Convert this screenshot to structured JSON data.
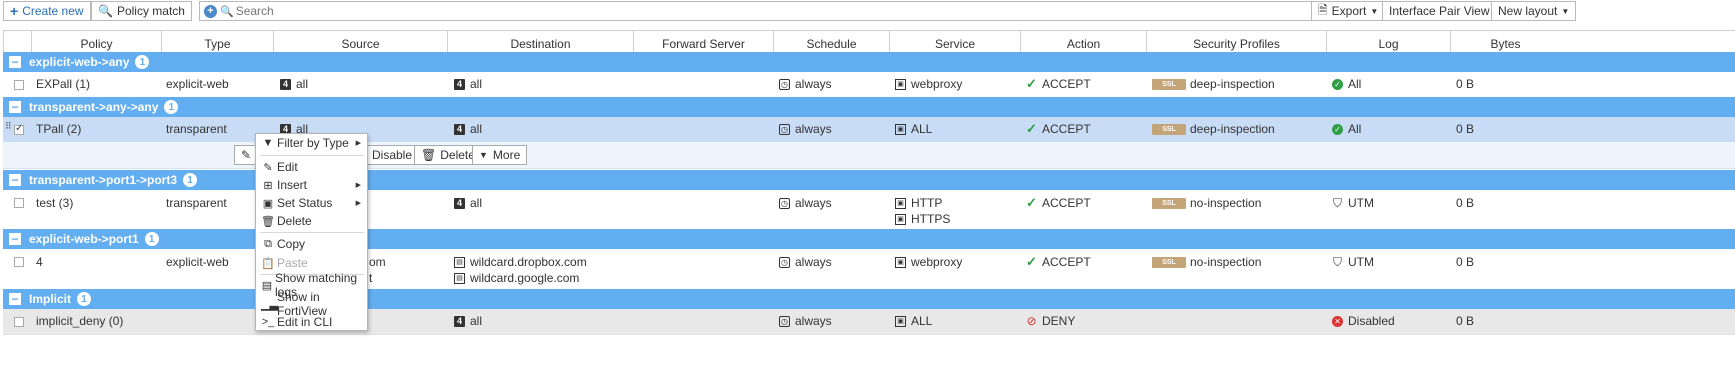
{
  "toolbar": {
    "create_new": "Create new",
    "policy_match": "Policy match",
    "search_placeholder": "Search",
    "export": "Export",
    "interface_pair_view": "Interface Pair View",
    "new_layout": "New layout"
  },
  "columns": [
    "Policy",
    "Type",
    "Source",
    "Destination",
    "Forward Server",
    "Schedule",
    "Service",
    "Action",
    "Security Profiles",
    "Log",
    "Bytes"
  ],
  "groups": [
    {
      "label": "explicit-web->any",
      "count": "1"
    },
    {
      "label": "transparent->any->any",
      "count": "1"
    },
    {
      "label": "transparent->port1->port3",
      "count": "1"
    },
    {
      "label": "explicit-web->port1",
      "count": "1"
    },
    {
      "label": "Implicit",
      "count": "1"
    }
  ],
  "rows": [
    {
      "policy": "EXPall (1)",
      "type": "explicit-web",
      "source": [
        "all"
      ],
      "destination": [
        "all"
      ],
      "schedule": "always",
      "service": [
        "webproxy"
      ],
      "action": "ACCEPT",
      "profile_badge": "SSL",
      "profile": "deep-inspection",
      "log": "All",
      "bytes": "0 B"
    },
    {
      "policy": "TPall (2)",
      "type": "transparent",
      "source": [
        "all"
      ],
      "destination": [
        "all"
      ],
      "schedule": "always",
      "service": [
        "ALL"
      ],
      "action": "ACCEPT",
      "profile_badge": "SSL",
      "profile": "deep-inspection",
      "log": "All",
      "bytes": "0 B"
    },
    {
      "policy": "test (3)",
      "type": "transparent",
      "source": [],
      "destination": [
        "all"
      ],
      "schedule": "always",
      "service": [
        "HTTP",
        "HTTPS"
      ],
      "action": "ACCEPT",
      "profile_badge": "SSL",
      "profile": "no-inspection",
      "log": "UTM",
      "bytes": "0 B"
    },
    {
      "policy": "4",
      "type": "explicit-web",
      "source": [
        "om",
        "t"
      ],
      "destination": [
        "wildcard.dropbox.com",
        "wildcard.google.com"
      ],
      "schedule": "always",
      "service": [
        "webproxy"
      ],
      "action": "ACCEPT",
      "profile_badge": "SSL",
      "profile": "no-inspection",
      "log": "UTM",
      "bytes": "0 B"
    },
    {
      "policy": "implicit_deny (0)",
      "type": "",
      "source": [],
      "destination": [
        "all"
      ],
      "schedule": "always",
      "service": [
        "ALL"
      ],
      "action": "DENY",
      "profile_badge": "",
      "profile": "",
      "log": "Disabled",
      "bytes": "0 B"
    }
  ],
  "row_actions": {
    "disable": "Disable",
    "delete": "Delete",
    "more": "More"
  },
  "context_menu": {
    "filter_by_type": "Filter by Type",
    "edit": "Edit",
    "insert": "Insert",
    "set_status": "Set Status",
    "delete": "Delete",
    "copy": "Copy",
    "paste": "Paste",
    "show_matching_logs": "Show matching logs",
    "show_in_fortiview": "Show in FortiView",
    "edit_in_cli": "Edit in CLI"
  },
  "colors": {
    "group_bar": "#63aef0",
    "selected_row": "#c9dcf5",
    "accept": "#2f9e44",
    "deny": "#dd3333",
    "ssl_badge": "#c4a57a"
  }
}
